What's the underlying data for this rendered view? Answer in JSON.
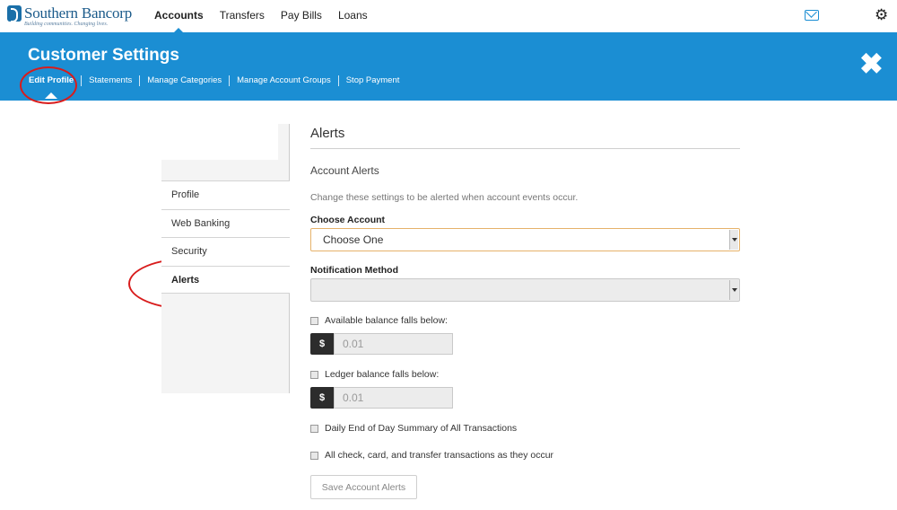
{
  "brand": {
    "name": "Southern Bancorp",
    "tagline": "Building communities. Changing lives."
  },
  "topnav": {
    "items": [
      "Accounts",
      "Transfers",
      "Pay Bills",
      "Loans"
    ],
    "active": "Accounts"
  },
  "icons": {
    "mail": "mail-icon",
    "settings": "gear-icon",
    "close": "close-icon"
  },
  "banner": {
    "title": "Customer Settings",
    "tabs": [
      "Edit Profile",
      "Statements",
      "Manage Categories",
      "Manage Account Groups",
      "Stop Payment"
    ],
    "active_tab": "Edit Profile"
  },
  "sidebar": {
    "items": [
      "Profile",
      "Web Banking",
      "Security",
      "Alerts"
    ],
    "active": "Alerts"
  },
  "main": {
    "title": "Alerts",
    "section_title": "Account Alerts",
    "help_text": "Change these settings to be alerted when account events occur.",
    "choose_account_label": "Choose Account",
    "choose_account_value": "Choose One",
    "notification_method_label": "Notification Method",
    "notification_method_value": "",
    "available_balance_label": "Available balance falls below:",
    "ledger_balance_label": "Ledger balance falls below:",
    "currency_symbol": "$",
    "amount_placeholder": "0.01",
    "daily_summary_label": "Daily End of Day Summary of All Transactions",
    "all_transactions_label": "All check, card, and transfer transactions as they occur",
    "save_label": "Save Account Alerts"
  },
  "colors": {
    "brand_blue": "#1b8ed3",
    "annotation_red": "#d81c1c",
    "select_focus": "#e6b26a"
  }
}
